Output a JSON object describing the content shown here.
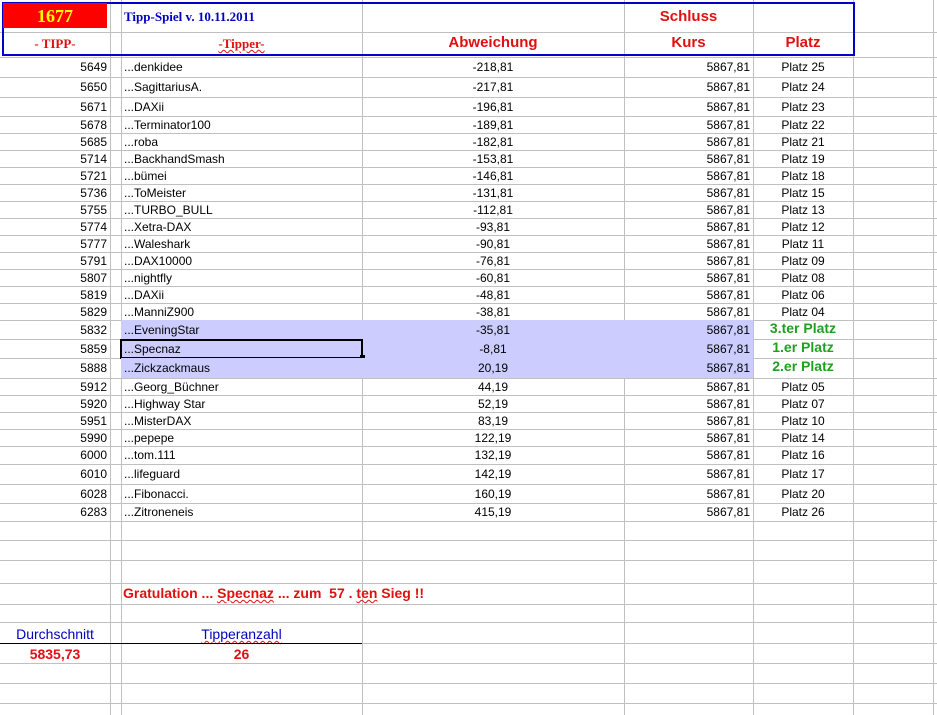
{
  "header": {
    "round": "1677",
    "title": "Tipp-Spiel v. 10.11.2011",
    "col_tipp": "- TIPP-",
    "col_tipper": "-Tipper-",
    "col_abweichung": "Abweichung",
    "col_schluss": "Schluss",
    "col_kurs": "Kurs",
    "col_platz": "Platz"
  },
  "rows": [
    {
      "tipp": "5649",
      "tipper": "...denkidee",
      "abw": "-218,81",
      "kurs": "5867,81",
      "platz": "Platz 25"
    },
    {
      "tipp": "5650",
      "tipper": "...SagittariusA.",
      "abw": "-217,81",
      "kurs": "5867,81",
      "platz": "Platz 24"
    },
    {
      "tipp": "5671",
      "tipper": "...DAXii",
      "abw": "-196,81",
      "kurs": "5867,81",
      "platz": "Platz 23"
    },
    {
      "tipp": "5678",
      "tipper": "...Terminator100",
      "abw": "-189,81",
      "kurs": "5867,81",
      "platz": "Platz 22"
    },
    {
      "tipp": "5685",
      "tipper": "...roba",
      "abw": "-182,81",
      "kurs": "5867,81",
      "platz": "Platz 21"
    },
    {
      "tipp": "5714",
      "tipper": "...BackhandSmash",
      "abw": "-153,81",
      "kurs": "5867,81",
      "platz": "Platz 19"
    },
    {
      "tipp": "5721",
      "tipper": "...bümei",
      "abw": "-146,81",
      "kurs": "5867,81",
      "platz": "Platz 18"
    },
    {
      "tipp": "5736",
      "tipper": "...ToMeister",
      "abw": "-131,81",
      "kurs": "5867,81",
      "platz": "Platz 15"
    },
    {
      "tipp": "5755",
      "tipper": "...TURBO_BULL",
      "abw": "-112,81",
      "kurs": "5867,81",
      "platz": "Platz 13"
    },
    {
      "tipp": "5774",
      "tipper": "...Xetra-DAX",
      "abw": "-93,81",
      "kurs": "5867,81",
      "platz": "Platz 12"
    },
    {
      "tipp": "5777",
      "tipper": "...Waleshark",
      "abw": "-90,81",
      "kurs": "5867,81",
      "platz": "Platz 11"
    },
    {
      "tipp": "5791",
      "tipper": "...DAX10000",
      "abw": "-76,81",
      "kurs": "5867,81",
      "platz": "Platz 09"
    },
    {
      "tipp": "5807",
      "tipper": "...nightfly",
      "abw": "-60,81",
      "kurs": "5867,81",
      "platz": "Platz 08"
    },
    {
      "tipp": "5819",
      "tipper": "...DAXii",
      "abw": "-48,81",
      "kurs": "5867,81",
      "platz": "Platz 06"
    },
    {
      "tipp": "5829",
      "tipper": "...ManniZ900",
      "abw": "-38,81",
      "kurs": "5867,81",
      "platz": "Platz 04"
    },
    {
      "tipp": "5832",
      "tipper": "...EveningStar",
      "abw": "-35,81",
      "kurs": "5867,81",
      "platz": "3.ter Platz",
      "winner": true
    },
    {
      "tipp": "5859",
      "tipper": "...Specnaz",
      "abw": "-8,81",
      "kurs": "5867,81",
      "platz": "1.er Platz",
      "winner": true,
      "selected": true
    },
    {
      "tipp": "5888",
      "tipper": "...Zickzackmaus",
      "abw": "20,19",
      "kurs": "5867,81",
      "platz": "2.er Platz",
      "winner": true
    },
    {
      "tipp": "5912",
      "tipper": "...Georg_Büchner",
      "abw": "44,19",
      "kurs": "5867,81",
      "platz": "Platz 05"
    },
    {
      "tipp": "5920",
      "tipper": "...Highway Star",
      "abw": "52,19",
      "kurs": "5867,81",
      "platz": "Platz 07"
    },
    {
      "tipp": "5951",
      "tipper": "...MisterDAX",
      "abw": "83,19",
      "kurs": "5867,81",
      "platz": "Platz 10"
    },
    {
      "tipp": "5990",
      "tipper": "...pepepe",
      "abw": "122,19",
      "kurs": "5867,81",
      "platz": "Platz 14"
    },
    {
      "tipp": "6000",
      "tipper": "...tom.111",
      "abw": "132,19",
      "kurs": "5867,81",
      "platz": "Platz 16"
    },
    {
      "tipp": "6010",
      "tipper": "...lifeguard",
      "abw": "142,19",
      "kurs": "5867,81",
      "platz": "Platz 17"
    },
    {
      "tipp": "6028",
      "tipper": "...Fibonacci.",
      "abw": "160,19",
      "kurs": "5867,81",
      "platz": "Platz 20"
    },
    {
      "tipp": "6283",
      "tipper": "...Zitroneneis",
      "abw": "415,19",
      "kurs": "5867,81",
      "platz": "Platz 26"
    }
  ],
  "footer": {
    "congrats_a": "Gratulation ... ",
    "congrats_name": "Specnaz",
    "congrats_b": " ... zum  57 . ",
    "congrats_ten": "ten",
    "congrats_c": " Sieg !!",
    "avg_label": "Durchschnitt",
    "avg_value": "5835,73",
    "count_label": "Tipperanzahl",
    "count_value": "26"
  },
  "colors": {
    "highlight": "#ccccff",
    "header_red": "#ff0000",
    "accent_blue": "#0000cc",
    "winner_green": "#20a020"
  }
}
